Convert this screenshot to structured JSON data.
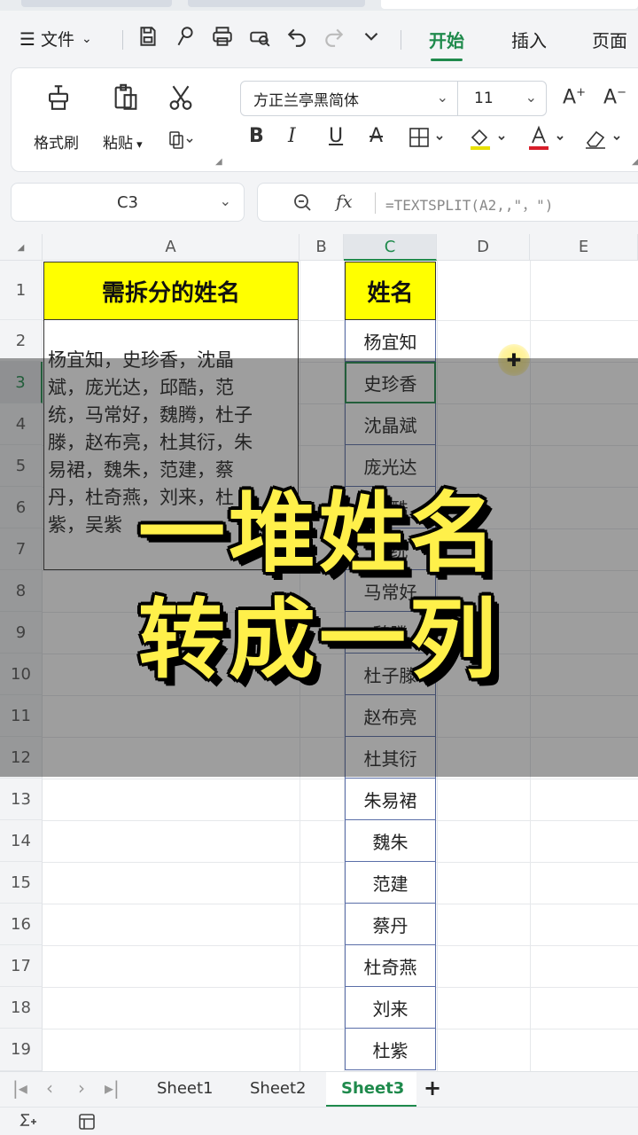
{
  "menu": {
    "file_label": "文件",
    "tabs": [
      "开始",
      "插入",
      "页面"
    ]
  },
  "ribbon": {
    "format_painter": "格式刷",
    "paste": "粘贴",
    "font_name": "方正兰亭黑简体",
    "font_size": "11"
  },
  "formula_bar": {
    "cell_ref": "C3",
    "fx": "fx",
    "formula": "=TEXTSPLIT(A2,,\"，\")"
  },
  "grid": {
    "columns": [
      "A",
      "B",
      "C",
      "D",
      "E"
    ],
    "rows": [
      "1",
      "2",
      "3",
      "4",
      "5",
      "6",
      "7",
      "8",
      "9",
      "10",
      "11",
      "12",
      "13",
      "14",
      "15",
      "16",
      "17",
      "18",
      "19"
    ],
    "a1": "需拆分的姓名",
    "a2_lines": [
      "杨宜知，史珍香，沈晶",
      "斌，庞光达，邱酷，范",
      "统，马常好，魏腾，杜子",
      "滕，赵布亮，杜其衍，朱",
      "易裙，魏朱，范建，蔡",
      "丹，杜奇燕，刘来，杜",
      "紫，吴紫"
    ],
    "c1": "姓名",
    "names": [
      "杨宜知",
      "史珍香",
      "沈晶斌",
      "庞光达",
      "邱酷",
      "范统",
      "马常好",
      "魏腾",
      "杜子滕",
      "赵布亮",
      "杜其衍",
      "朱易裙",
      "魏朱",
      "范建",
      "蔡丹",
      "杜奇燕",
      "刘来",
      "杜紫"
    ]
  },
  "overlay": {
    "line1": "一堆姓名",
    "line2": "转成一列"
  },
  "sheets": [
    "Sheet1",
    "Sheet2",
    "Sheet3"
  ],
  "active_sheet": "Sheet3",
  "colors": {
    "accent": "#1f8a4c",
    "highlight": "#ffff00",
    "overlay_text": "#fff04a"
  }
}
